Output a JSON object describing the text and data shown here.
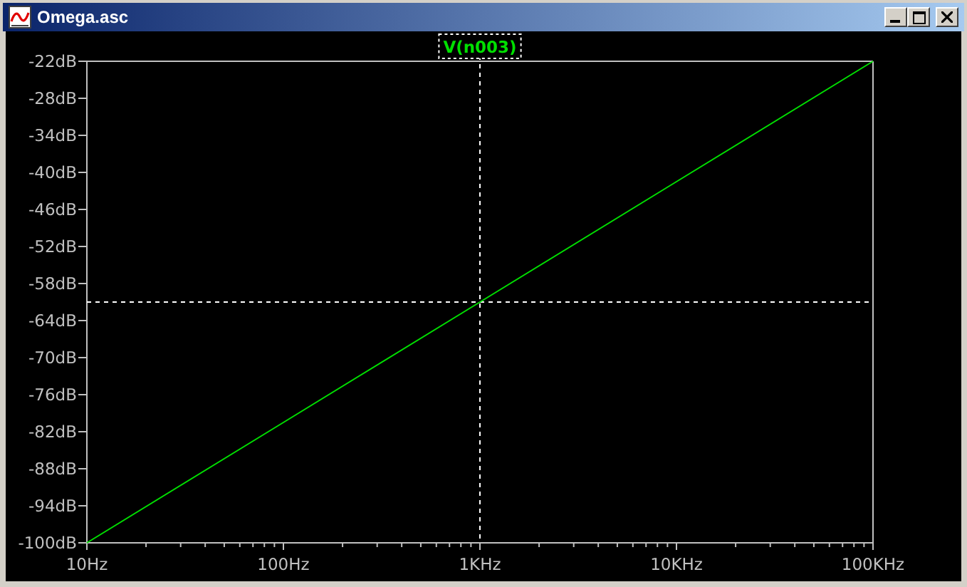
{
  "window": {
    "title": "Omega.asc"
  },
  "plot": {
    "chart_data": {
      "type": "line",
      "categories": [
        "10Hz",
        "100Hz",
        "1KHz",
        "10KHz",
        "100KHz"
      ],
      "series": [
        {
          "name": "V(n003)",
          "color": "#00e000",
          "values": [
            -100,
            -80.5,
            -61,
            -41.5,
            -22
          ]
        }
      ],
      "ylim": [
        -100,
        -22
      ],
      "yticks": [
        {
          "value": -22,
          "label": "-22dB"
        },
        {
          "value": -28,
          "label": "-28dB"
        },
        {
          "value": -34,
          "label": "-34dB"
        },
        {
          "value": -40,
          "label": "-40dB"
        },
        {
          "value": -46,
          "label": "-46dB"
        },
        {
          "value": -52,
          "label": "-52dB"
        },
        {
          "value": -58,
          "label": "-58dB"
        },
        {
          "value": -64,
          "label": "-64dB"
        },
        {
          "value": -70,
          "label": "-70dB"
        },
        {
          "value": -76,
          "label": "-76dB"
        },
        {
          "value": -82,
          "label": "-82dB"
        },
        {
          "value": -88,
          "label": "-88dB"
        },
        {
          "value": -94,
          "label": "-94dB"
        },
        {
          "value": -100,
          "label": "-100dB"
        }
      ],
      "annotations": [
        {
          "x": "1KHz"
        }
      ]
    }
  }
}
